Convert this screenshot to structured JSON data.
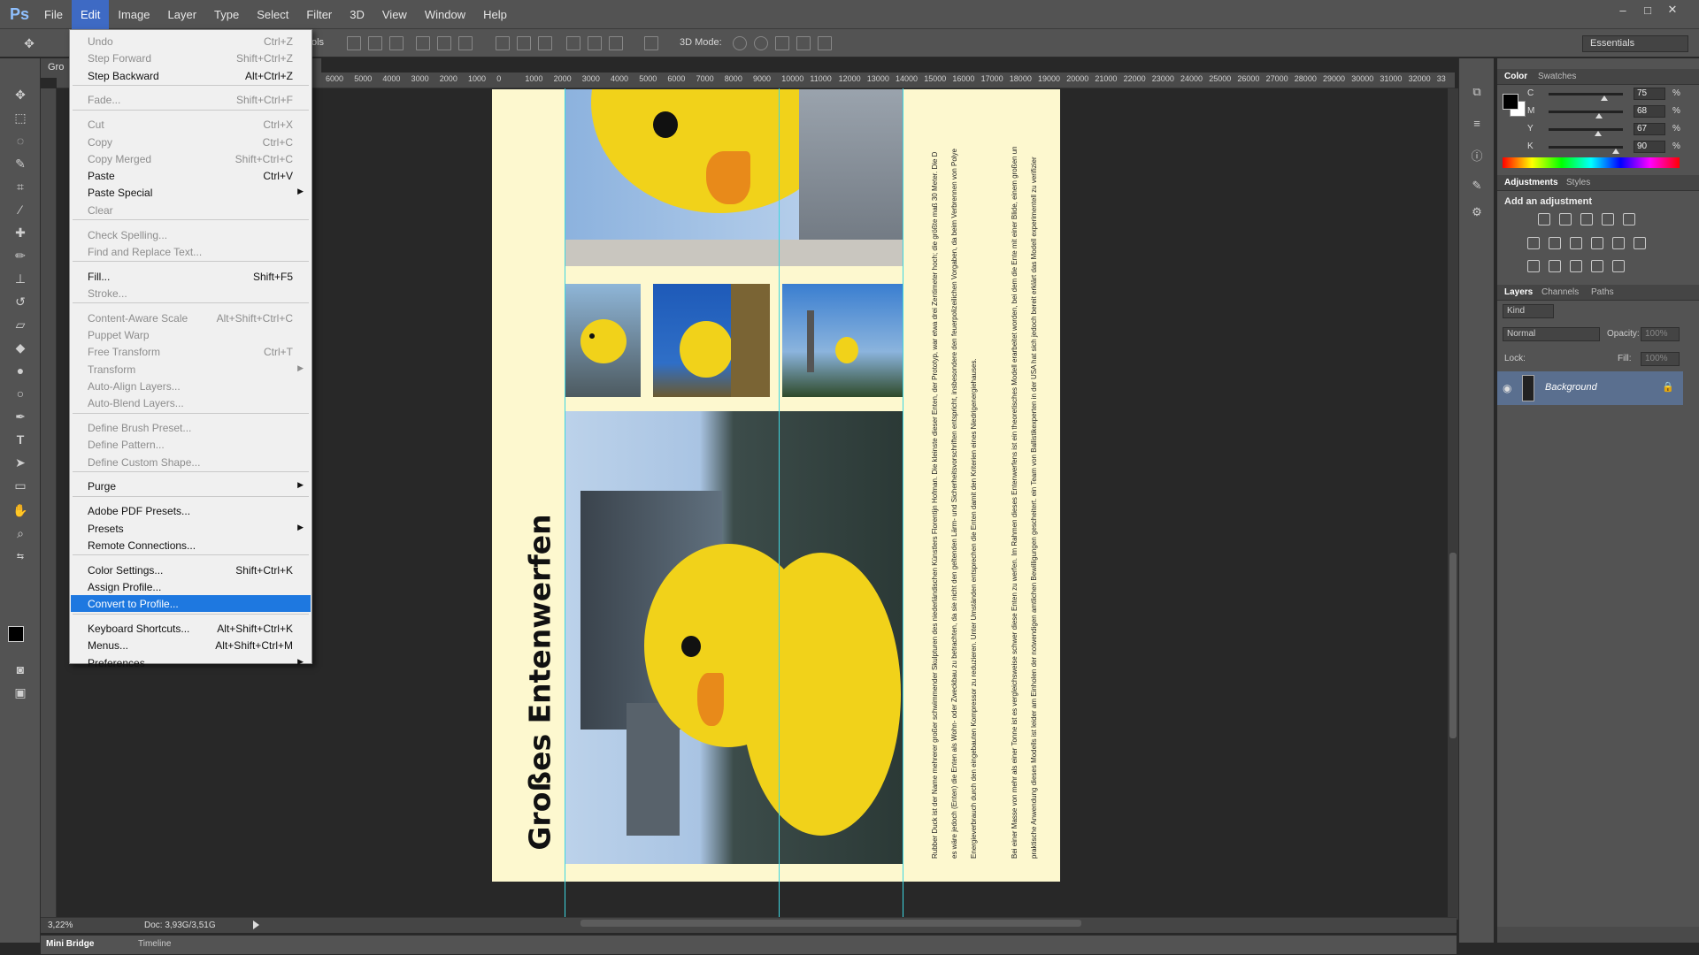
{
  "app": {
    "logo": "Ps"
  },
  "menubar": {
    "items": [
      "File",
      "Edit",
      "Image",
      "Layer",
      "Type",
      "Select",
      "Filter",
      "3D",
      "View",
      "Window",
      "Help"
    ],
    "active": "Edit"
  },
  "window_controls": {
    "minimize": "–",
    "maximize": "□",
    "close": "✕"
  },
  "options": {
    "mode3d_label": "3D Mode:",
    "workspace": "Essentials",
    "partial_label": "ols"
  },
  "document": {
    "tab_title": "Gro",
    "zoom": "3,22%",
    "doc_info": "Doc: 3,93G/3,51G"
  },
  "ruler": {
    "h_labels": [
      "6000",
      "5000",
      "4000",
      "3000",
      "2000",
      "1000",
      "0",
      "1000",
      "2000",
      "3000",
      "4000",
      "5000",
      "6000",
      "7000",
      "8000",
      "9000",
      "10000",
      "11000",
      "12000",
      "13000",
      "14000",
      "15000",
      "16000",
      "17000",
      "18000",
      "19000",
      "20000",
      "21000",
      "22000",
      "23000",
      "24000",
      "25000",
      "26000",
      "27000",
      "28000",
      "29000",
      "30000",
      "31000",
      "32000",
      "33"
    ]
  },
  "page": {
    "title": "Großes Entenwerfen",
    "body_columns": [
      "Rubber Duck ist der Name mehrerer großer schwimmender Skulpturen des niederländischen Künstlers Florentijn Hofman. Die kleinste dieser Enten, der Prototyp, war etwa drei Zentimeter hoch; die größte maß 30 Meter. Die D",
      "es wäre jedoch (Enten) die Enten als Wohn- oder Zweckbau zu betrachten, da sie nicht den geltenden Lärm- und Sicherheitsvorschriften entspricht, insbesondere den feuerpolizeilichen Vorgaben, da beim Verbrennen von Polye",
      "Energieverbrauch durch den eingebauten Kompressor zu reduzieren. Unter Umständen entsprechen die Enten damit den Kriterien eines Niedrigenergiehauses.",
      "Bei einer Masse von mehr als einer Tonne ist es vergleichsweise schwer diese Enten zu werfen. Im Rahmen dieses Entenwerfens ist ein theoretisches Modell erarbeitet worden, bei dem die Ente mit einer Blide, einem großen un",
      "praktische Anwendung dieses Modells ist leider am Einholen der notwendigen amtlichen Bewilligungen gescheitert. ein Team von Ballistikexperten in der USA hat sich jedoch bereit erklärt das Modell experimentell zu verifizier"
    ]
  },
  "edit_menu": {
    "items": [
      {
        "label": "Undo",
        "shortcut": "Ctrl+Z",
        "disabled": true
      },
      {
        "label": "Step Forward",
        "shortcut": "Shift+Ctrl+Z",
        "disabled": true
      },
      {
        "label": "Step Backward",
        "shortcut": "Alt+Ctrl+Z",
        "disabled": false
      },
      {
        "label": "Fade...",
        "shortcut": "Shift+Ctrl+F",
        "disabled": true
      },
      {
        "label": "Cut",
        "shortcut": "Ctrl+X",
        "disabled": true
      },
      {
        "label": "Copy",
        "shortcut": "Ctrl+C",
        "disabled": true
      },
      {
        "label": "Copy Merged",
        "shortcut": "Shift+Ctrl+C",
        "disabled": true
      },
      {
        "label": "Paste",
        "shortcut": "Ctrl+V",
        "disabled": false
      },
      {
        "label": "Paste Special",
        "shortcut": "",
        "disabled": false
      },
      {
        "label": "Clear",
        "shortcut": "",
        "disabled": true
      },
      {
        "label": "Check Spelling...",
        "shortcut": "",
        "disabled": true
      },
      {
        "label": "Find and Replace Text...",
        "shortcut": "",
        "disabled": true
      },
      {
        "label": "Fill...",
        "shortcut": "Shift+F5",
        "disabled": false
      },
      {
        "label": "Stroke...",
        "shortcut": "",
        "disabled": true
      },
      {
        "label": "Content-Aware Scale",
        "shortcut": "Alt+Shift+Ctrl+C",
        "disabled": true
      },
      {
        "label": "Puppet Warp",
        "shortcut": "",
        "disabled": true
      },
      {
        "label": "Free Transform",
        "shortcut": "Ctrl+T",
        "disabled": true
      },
      {
        "label": "Transform",
        "shortcut": "",
        "disabled": true
      },
      {
        "label": "Auto-Align Layers...",
        "shortcut": "",
        "disabled": true
      },
      {
        "label": "Auto-Blend Layers...",
        "shortcut": "",
        "disabled": true
      },
      {
        "label": "Define Brush Preset...",
        "shortcut": "",
        "disabled": true
      },
      {
        "label": "Define Pattern...",
        "shortcut": "",
        "disabled": true
      },
      {
        "label": "Define Custom Shape...",
        "shortcut": "",
        "disabled": true
      },
      {
        "label": "Purge",
        "shortcut": "",
        "disabled": false
      },
      {
        "label": "Adobe PDF Presets...",
        "shortcut": "",
        "disabled": false
      },
      {
        "label": "Presets",
        "shortcut": "",
        "disabled": false
      },
      {
        "label": "Remote Connections...",
        "shortcut": "",
        "disabled": false
      },
      {
        "label": "Color Settings...",
        "shortcut": "Shift+Ctrl+K",
        "disabled": false
      },
      {
        "label": "Assign Profile...",
        "shortcut": "",
        "disabled": false
      },
      {
        "label": "Convert to Profile...",
        "shortcut": "",
        "disabled": false,
        "highlighted": true
      },
      {
        "label": "Keyboard Shortcuts...",
        "shortcut": "Alt+Shift+Ctrl+K",
        "disabled": false
      },
      {
        "label": "Menus...",
        "shortcut": "Alt+Shift+Ctrl+M",
        "disabled": false
      },
      {
        "label": "Preferences",
        "shortcut": "",
        "disabled": false
      }
    ]
  },
  "color_panel": {
    "tabs": [
      "Color",
      "Swatches"
    ],
    "sliders": [
      {
        "label": "C",
        "value": "75",
        "unit": "%"
      },
      {
        "label": "M",
        "value": "68",
        "unit": "%"
      },
      {
        "label": "Y",
        "value": "67",
        "unit": "%"
      },
      {
        "label": "K",
        "value": "90",
        "unit": "%"
      }
    ]
  },
  "adjustments_panel": {
    "tabs": [
      "Adjustments",
      "Styles"
    ],
    "heading": "Add an adjustment"
  },
  "layers_panel": {
    "tabs": [
      "Layers",
      "Channels",
      "Paths"
    ],
    "filter": "Kind",
    "blend_mode": "Normal",
    "opacity_label": "Opacity:",
    "opacity_value": "100%",
    "lock_label": "Lock:",
    "fill_label": "Fill:",
    "fill_value": "100%",
    "layer_name": "Background"
  },
  "bottom_tabs": [
    "Mini Bridge",
    "Timeline"
  ],
  "colors": {
    "menu_highlight": "#1e78e0",
    "guide": "#3ed6e0",
    "page_bg": "#fdf8cf",
    "duck": "#f1d21a"
  }
}
